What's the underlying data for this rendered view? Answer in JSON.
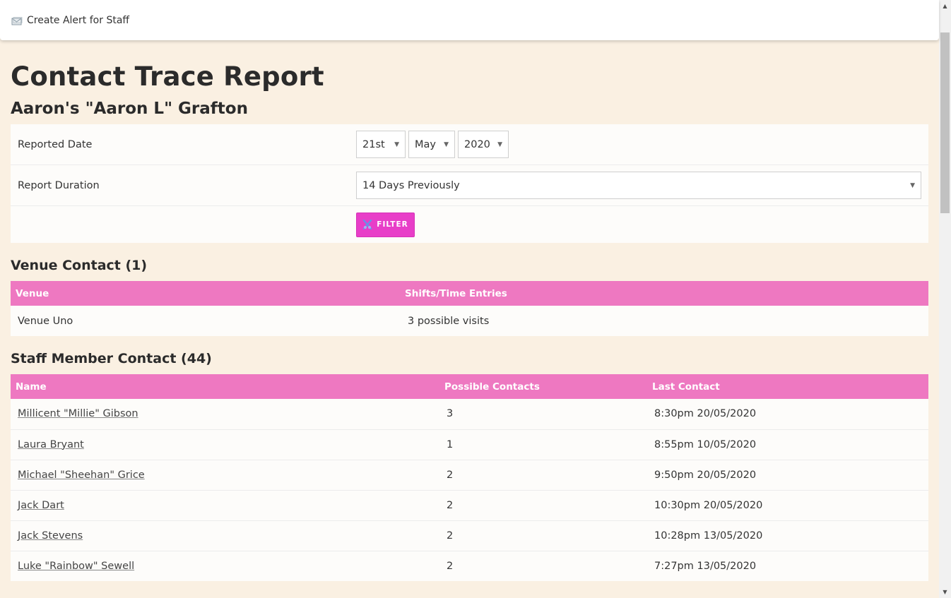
{
  "topbar": {
    "create_alert_label": "Create Alert for Staff"
  },
  "page": {
    "title": "Contact Trace Report",
    "person_name": "Aaron's \"Aaron L\" Grafton"
  },
  "filters": {
    "reported_date_label": "Reported Date",
    "day": "21st",
    "month": "May",
    "year": "2020",
    "duration_label": "Report Duration",
    "duration": "14 Days Previously",
    "filter_button": "FILTER"
  },
  "venue_section": {
    "title": "Venue Contact (1)",
    "columns": [
      "Venue",
      "Shifts/Time Entries"
    ],
    "rows": [
      {
        "venue": "Venue Uno",
        "entries": "3 possible visits"
      }
    ]
  },
  "staff_section": {
    "title": "Staff Member Contact (44)",
    "columns": [
      "Name",
      "Possible Contacts",
      "Last Contact"
    ],
    "rows": [
      {
        "name": "Millicent \"Millie\" Gibson",
        "contacts": "3",
        "last": "8:30pm 20/05/2020"
      },
      {
        "name": "Laura Bryant",
        "contacts": "1",
        "last": "8:55pm 10/05/2020"
      },
      {
        "name": "Michael \"Sheehan\" Grice",
        "contacts": "2",
        "last": "9:50pm 20/05/2020"
      },
      {
        "name": "Jack Dart",
        "contacts": "2",
        "last": "10:30pm 20/05/2020"
      },
      {
        "name": "Jack Stevens",
        "contacts": "2",
        "last": "10:28pm 13/05/2020"
      },
      {
        "name": "Luke \"Rainbow\" Sewell",
        "contacts": "2",
        "last": "7:27pm 13/05/2020"
      }
    ]
  },
  "colors": {
    "page_bg": "#faf0e2",
    "header_pink": "#ee78c1",
    "button_magenta": "#e83ec8"
  }
}
